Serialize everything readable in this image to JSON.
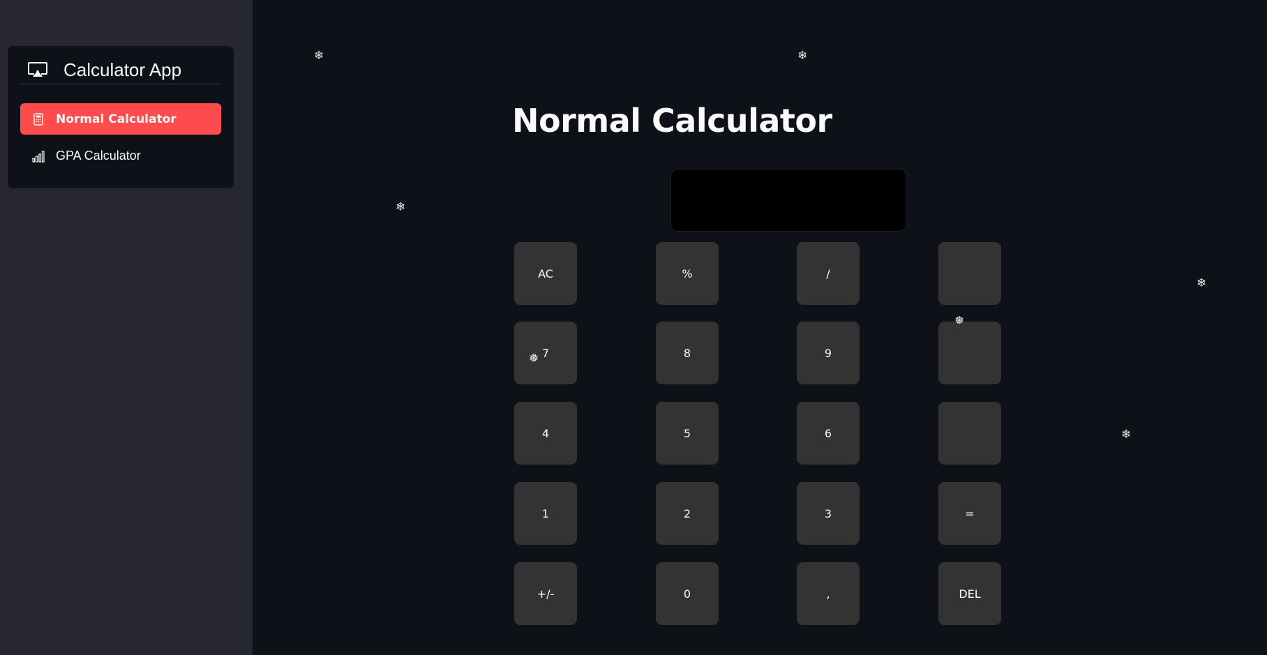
{
  "sidebar": {
    "app_title": "Calculator App",
    "app_icon": "screen-cast-icon",
    "nav_items": [
      {
        "label": "Normal Calculator",
        "icon": "calculator-icon",
        "active": true
      },
      {
        "label": "GPA Calculator",
        "icon": "bar-chart-icon",
        "active": false
      }
    ],
    "accent_color": "#ff4b4b"
  },
  "main": {
    "title": "Normal Calculator",
    "display_value": "",
    "buttons": [
      "AC",
      "%",
      "/",
      "",
      "7",
      "8",
      "9",
      "",
      "4",
      "5",
      "6",
      "",
      "1",
      "2",
      "3",
      "=",
      "+/-",
      "0",
      ",",
      "DEL"
    ]
  },
  "decor": {
    "snowflake_glyph": "❄",
    "snowflake_glyph_alt": "❅"
  }
}
